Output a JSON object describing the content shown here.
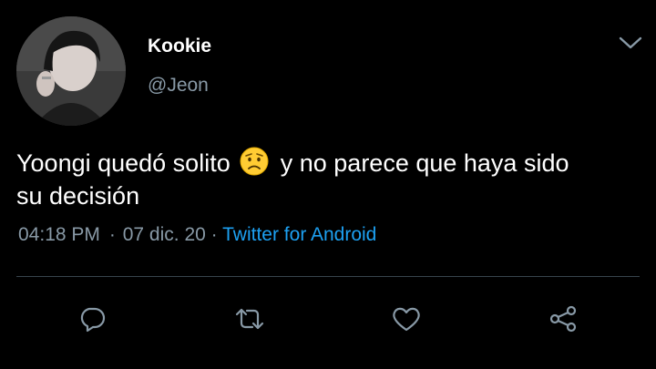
{
  "tweet": {
    "user": {
      "display_name": "Kookie",
      "handle": "@Jeon",
      "avatar": "profile-photo"
    },
    "text_before_emoji": "Yoongi quedó solito",
    "emoji": "worried-face-emoji",
    "text_after_emoji": "y no parece que haya sido\nsu decisión",
    "time": "04:18 PM",
    "date": "07 dic. 20",
    "source": "Twitter for Android",
    "dot": "·"
  },
  "icons": {
    "menu": "chevron-down-icon",
    "reply": "reply-icon",
    "retweet": "retweet-icon",
    "like": "heart-icon",
    "share": "share-icon"
  },
  "colors": {
    "background": "#000000",
    "text": "#ffffff",
    "secondary_text": "#8899a6",
    "link": "#1da1f2",
    "divider": "#38444d",
    "icon": "#8899a6"
  }
}
